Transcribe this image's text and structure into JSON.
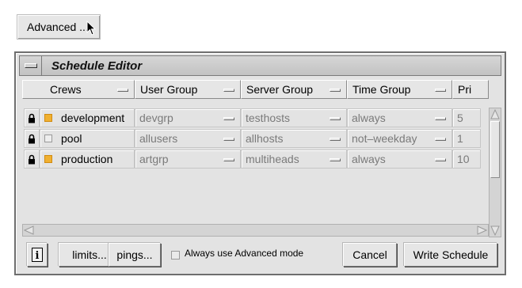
{
  "advanced_button": {
    "label": "Advanced ..."
  },
  "window": {
    "title": "Schedule Editor"
  },
  "columns": [
    "Crews",
    "User Group",
    "Server Group",
    "Time Group",
    "Pri"
  ],
  "rows": [
    {
      "crew": "development",
      "crew_color": "#f0b030",
      "user_group": "devgrp",
      "server_group": "testhosts",
      "time_group": "always",
      "pri": "5"
    },
    {
      "crew": "pool",
      "crew_color": "#e8e8e8",
      "user_group": "allusers",
      "server_group": "allhosts",
      "time_group": "not–weekday",
      "pri": "1"
    },
    {
      "crew": "production",
      "crew_color": "#f0b030",
      "user_group": "artgrp",
      "server_group": "multiheads",
      "time_group": "always",
      "pri": "10"
    }
  ],
  "bottom": {
    "info_icon": "info-icon",
    "limits_label": "limits...",
    "pings_label": "pings...",
    "checkbox_label": "Always use Advanced mode",
    "checkbox_checked": false,
    "cancel_label": "Cancel",
    "write_label": "Write Schedule"
  }
}
